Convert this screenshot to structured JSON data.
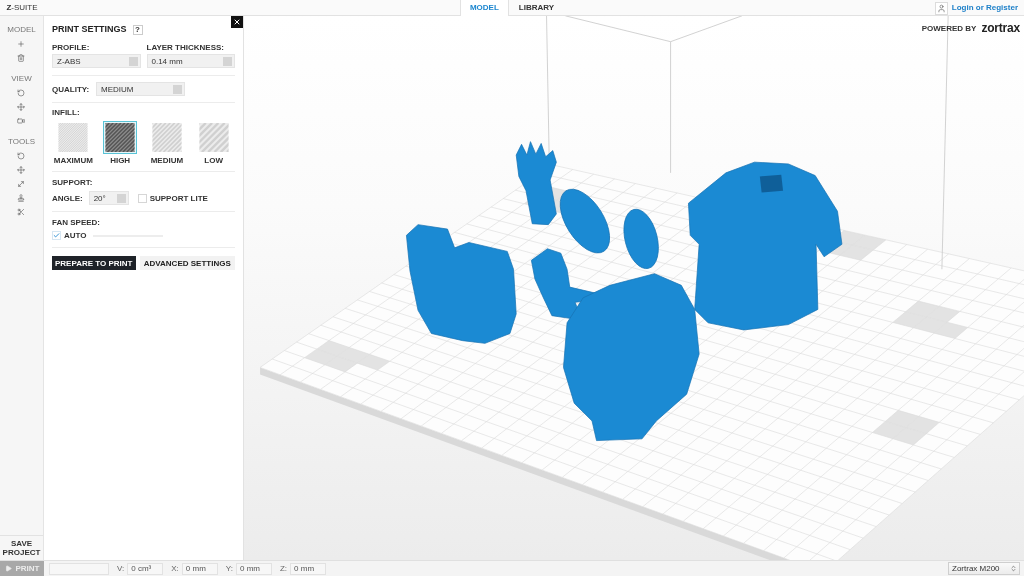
{
  "top_bar": {
    "logo": "**Z**-SUITE",
    "tabs": [
      {
        "label": "MODEL",
        "selected": true
      },
      {
        "label": "LIBRARY",
        "selected": false
      }
    ],
    "account_link": "Login or Register"
  },
  "toolbar": {
    "sections": [
      {
        "label": "MODEL"
      },
      {
        "label": "VIEW"
      },
      {
        "label": "TOOLS"
      }
    ],
    "save_button": "SAVE PROJECT"
  },
  "panel": {
    "title": "PRINT SETTINGS",
    "help": "?",
    "profile": {
      "label": "PROFILE:",
      "value": "Z-ABS"
    },
    "layer_thickness": {
      "label": "LAYER THICKNESS:",
      "value": "0.14 mm"
    },
    "quality": {
      "label": "QUALITY:",
      "value": "MEDIUM"
    },
    "infill": {
      "label": "INFILL:",
      "options": [
        {
          "label": "MAXIMUM",
          "selected": false
        },
        {
          "label": "HIGH",
          "selected": true
        },
        {
          "label": "MEDIUM",
          "selected": false
        },
        {
          "label": "LOW",
          "selected": false
        }
      ]
    },
    "support": {
      "label": "SUPPORT:",
      "angle_label": "ANGLE:",
      "angle_value": "20°",
      "lite": {
        "label": "SUPPORT LITE",
        "checked": false
      }
    },
    "fan_speed": {
      "label": "FAN SPEED:",
      "auto": {
        "label": "AUTO",
        "checked": true
      }
    },
    "buttons": [
      {
        "label": "PREPARE TO PRINT",
        "kind": "primary"
      },
      {
        "label": "ADVANCED SETTINGS",
        "kind": "secondary"
      }
    ]
  },
  "viewport": {
    "powered_by": "POWERED BY",
    "brand": "zortrax"
  },
  "bottom_bar": {
    "print_button": {
      "label": "PRINT",
      "disabled": true
    },
    "readouts": [
      {
        "label": "V:",
        "value": "0 cm³"
      },
      {
        "label": "X:",
        "value": "0 mm"
      },
      {
        "label": "Y:",
        "value": "0 mm"
      },
      {
        "label": "Z:",
        "value": "0 mm"
      }
    ],
    "printer": "Zortrax M200"
  }
}
